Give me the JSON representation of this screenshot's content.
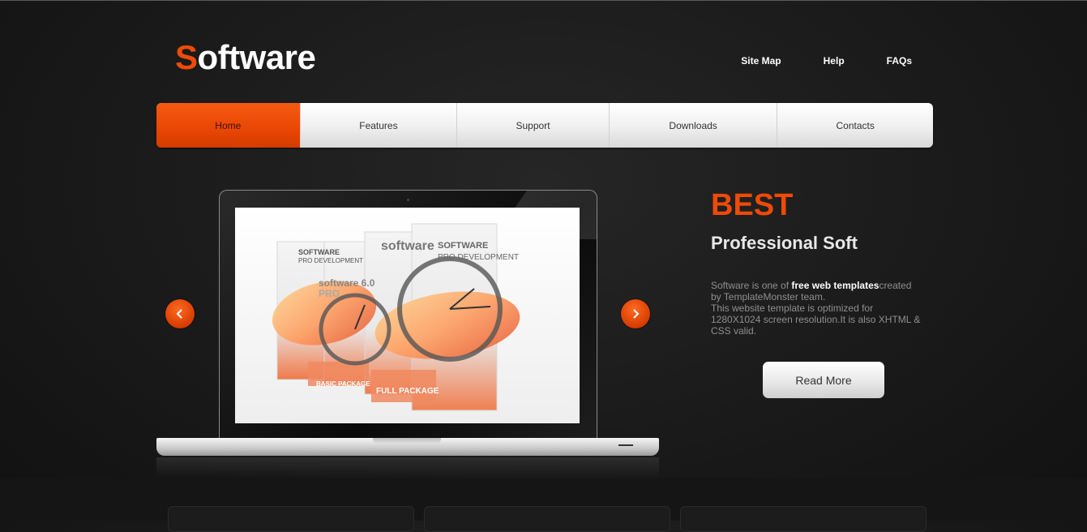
{
  "logo": {
    "first_letter": "S",
    "rest": "oftware"
  },
  "top_links": [
    "Site Map",
    "Help",
    "FAQs"
  ],
  "menu": {
    "items": [
      "Home",
      "Features",
      "Support",
      "Downloads",
      "Contacts"
    ],
    "active": "Home"
  },
  "hero": {
    "title": "BEST",
    "subtitle": "Professional Soft",
    "description": {
      "part1": "Software is one of ",
      "bold": "free web templates",
      "part2": "created by TemplateMonster team.",
      "line2": "This website template is optimized for 1280X1024 screen resolution.It is also XHTML & CSS valid."
    },
    "button_label": "Read More"
  },
  "slider": {
    "prev_icon": "chevron-left-icon",
    "next_icon": "chevron-right-icon"
  },
  "screen_art": {
    "box1_line1": "SOFTWARE",
    "box1_line2": "PRO DEVELOPMENT",
    "box2_brand": "software 6.0",
    "box2_sub": "PRO",
    "label_basic": "BASIC PACKAGE",
    "label_full": "FULL PACKAGE",
    "box3_brand": "software",
    "box3_line1": "SOFTWARE",
    "box3_line2": "PRO DEVELOPMENT"
  },
  "colors": {
    "accent": "#ee4a08",
    "background": "#1a1a1a",
    "menu_bg": "#f1f1f1",
    "text_muted": "#8f8f8f"
  }
}
